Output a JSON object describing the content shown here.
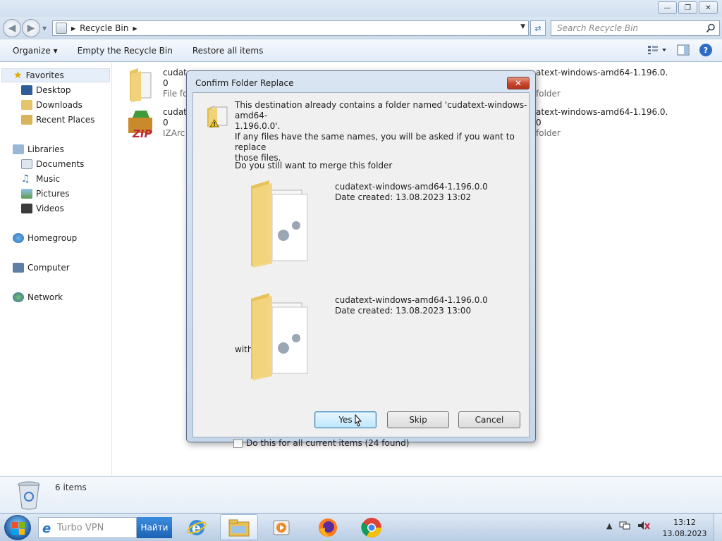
{
  "window": {
    "minimize": "—",
    "maximize": "❐",
    "close": "✕"
  },
  "address": {
    "path": "Recycle Bin",
    "search_placeholder": "Search Recycle Bin"
  },
  "toolbar": {
    "organize": "Organize ▾",
    "empty": "Empty the Recycle Bin",
    "restore": "Restore all items"
  },
  "nav": {
    "favorites": "Favorites",
    "desktop": "Desktop",
    "downloads": "Downloads",
    "recent": "Recent Places",
    "libraries": "Libraries",
    "documents": "Documents",
    "music": "Music",
    "pictures": "Pictures",
    "videos": "Videos",
    "homegroup": "Homegroup",
    "computer": "Computer",
    "network": "Network"
  },
  "files": [
    {
      "name": "cudate",
      "line2": "0",
      "line3": "File fo"
    },
    {
      "name": "cudate",
      "line2": "0",
      "line3": "IZArc Z"
    },
    {
      "name": "atext-windows-amd64-1.196.0.",
      "line2": "",
      "line3": "folder"
    },
    {
      "name": "atext-windows-amd64-1.196.0.",
      "line2": "0",
      "line3": "folder"
    }
  ],
  "status": {
    "count": "6 items"
  },
  "dialog": {
    "title": "Confirm Folder Replace",
    "close": "✕",
    "message_line1": "This destination already contains a folder named 'cudatext-windows-amd64-",
    "message_line2": "1.196.0.0'.",
    "info_line1": "If any files have the same names, you will be asked if you want to replace",
    "info_line2": "those files.",
    "question": "Do you still want to merge this folder",
    "source_name": "cudatext-windows-amd64-1.196.0.0",
    "source_date": "Date created: 13.08.2023 13:02",
    "with_text": "with this one?",
    "dest_name": "cudatext-windows-amd64-1.196.0.0",
    "dest_date": "Date created: 13.08.2023 13:00",
    "yes": "Yes",
    "skip": "Skip",
    "cancel": "Cancel",
    "checkbox_label": "Do this for all current items (24 found)",
    "checkbox_checked": false
  },
  "taskbar": {
    "vpn_text": "Turbo VPN",
    "vpn_button": "Найти",
    "time": "13:12",
    "date": "13.08.2023"
  },
  "colors": {
    "accent": "#3c7fb1",
    "title_bg": "#d2e0f0",
    "close_red": "#c9452c"
  }
}
